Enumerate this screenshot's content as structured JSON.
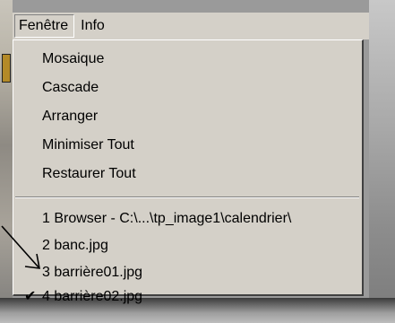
{
  "menubar": {
    "menus": [
      {
        "label": "Fenêtre",
        "active": true
      },
      {
        "label": "Info",
        "active": false
      }
    ]
  },
  "dropdown": {
    "items": [
      {
        "label": "Mosaique"
      },
      {
        "label": "Cascade"
      },
      {
        "label": "Arranger"
      },
      {
        "label": "Minimiser Tout"
      },
      {
        "label": "Restaurer Tout"
      }
    ],
    "windows": [
      {
        "label": "1 Browser - C:\\...\\tp_image1\\calendrier\\",
        "checked": false
      },
      {
        "label": "2 banc.jpg",
        "checked": false
      },
      {
        "label": "3 barrière01.jpg",
        "checked": false
      },
      {
        "label": "4 barrière02.jpg",
        "checked": true
      }
    ],
    "check_glyph": "✔"
  },
  "annotation": {
    "icon": "arrow-icon"
  }
}
